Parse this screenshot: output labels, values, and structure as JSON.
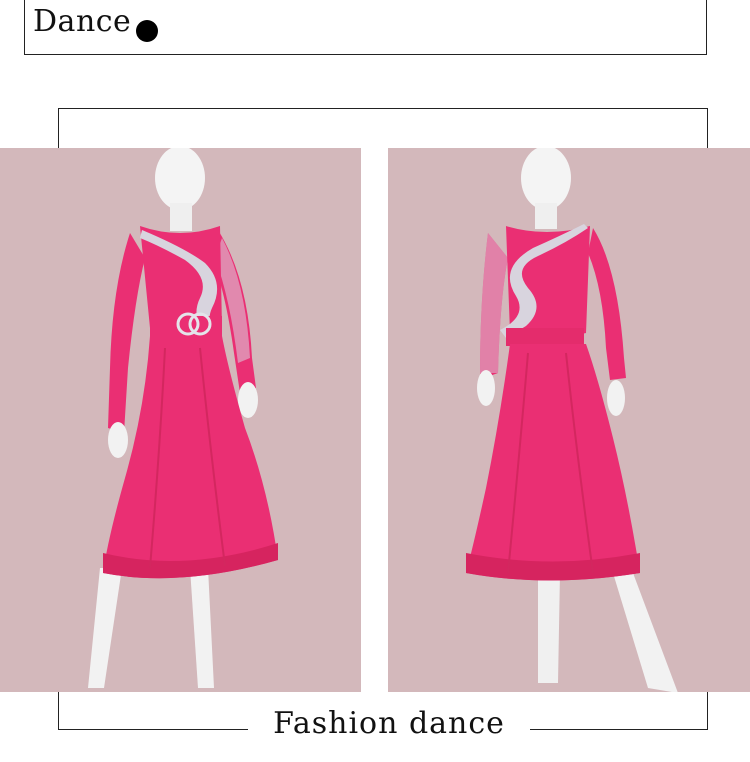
{
  "header": {
    "title": "Dance",
    "dot_icon": "filled-circle"
  },
  "caption": {
    "text": "Fashion dance"
  },
  "colors": {
    "photo_background": "#d3b8bb",
    "dress": "#ea2f73",
    "mannequin": "#f2f2f2",
    "rhinestones": "#d8d4de"
  },
  "photos": [
    {
      "view": "front",
      "subject": "dress-on-mannequin-front"
    },
    {
      "view": "back",
      "subject": "dress-on-mannequin-back"
    }
  ]
}
